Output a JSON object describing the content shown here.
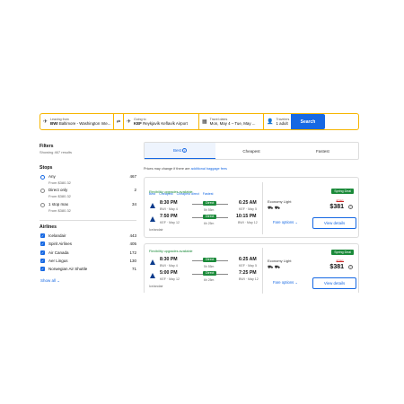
{
  "search": {
    "leaving_label": "Leaving from",
    "leaving_code": "BWI",
    "leaving_value": "Baltimore - Washington Inte...",
    "going_label": "Going to",
    "going_code": "KEF",
    "going_value": "Reykjavík Keflavík Airport",
    "dates_label": "Travel dates",
    "dates_value": "Mon, May 4 – Tue, May ...",
    "travelers_label": "Travelers",
    "travelers_value": "1 adult",
    "search_button": "Search"
  },
  "filters": {
    "title": "Filters",
    "results": "Showing 467 results",
    "stops_title": "Stops",
    "stops": [
      {
        "label": "Any",
        "from": "From $380.32",
        "count": "467"
      },
      {
        "label": "Direct only",
        "from": "From $380.32",
        "count": "2"
      },
      {
        "label": "1 stop max",
        "from": "From $380.32",
        "count": "34"
      }
    ],
    "airlines_title": "Airlines",
    "airlines": [
      {
        "label": "Icelandair",
        "count": "443"
      },
      {
        "label": "Spirit Airlines",
        "count": "405"
      },
      {
        "label": "Air Canada",
        "count": "172"
      },
      {
        "label": "Aer Lingus",
        "count": "130"
      },
      {
        "label": "Norwegian Air Shuttle",
        "count": "71"
      }
    ],
    "show_all": "Show all"
  },
  "tabs": {
    "best": "Best",
    "cheapest": "Cheapest",
    "fastest": "Fastest"
  },
  "notice": {
    "text": "Prices may change if there are",
    "link": "additional baggage fees"
  },
  "cards": [
    {
      "tags": [
        "Best",
        "Cheapest",
        "Cheapest direct",
        "Fastest"
      ],
      "flex": "Flexibility upgrades available",
      "out": {
        "dep": "8:30 PM",
        "dep_sub": "BWI · May 4",
        "direct": "Direct",
        "dur": "5h 55m",
        "arr": "6:25 AM",
        "arr_sub": "KEF · May 5"
      },
      "ret": {
        "dep": "7:50 PM",
        "dep_sub": "KEF · May 12",
        "direct": "Direct",
        "dur": "6h 25m",
        "arr": "10:15 PM",
        "arr_sub": "BWI · May 12"
      },
      "airline": "Icelandair",
      "fare_class": "Economy Light",
      "deal": "Spring Deal",
      "old_price": "$391",
      "price": "$381",
      "fare_options": "Fare options",
      "view": "View details"
    },
    {
      "tags": [],
      "flex": "Flexibility upgrades available",
      "out": {
        "dep": "8:30 PM",
        "dep_sub": "BWI · May 4",
        "direct": "Direct",
        "dur": "5h 55m",
        "arr": "6:25 AM",
        "arr_sub": "KEF · May 5"
      },
      "ret": {
        "dep": "5:00 PM",
        "dep_sub": "KEF · May 12",
        "direct": "Direct",
        "dur": "6h 25m",
        "arr": "7:25 PM",
        "arr_sub": "BWI · May 12"
      },
      "airline": "Icelandair",
      "fare_class": "Economy Light",
      "deal": "Spring Deal",
      "old_price": "$391",
      "price": "$381",
      "fare_options": "Fare options",
      "view": "View details"
    }
  ],
  "colors": {
    "accent": "#1668e3",
    "border": "#f6b500",
    "deal": "#1b8a3a"
  }
}
